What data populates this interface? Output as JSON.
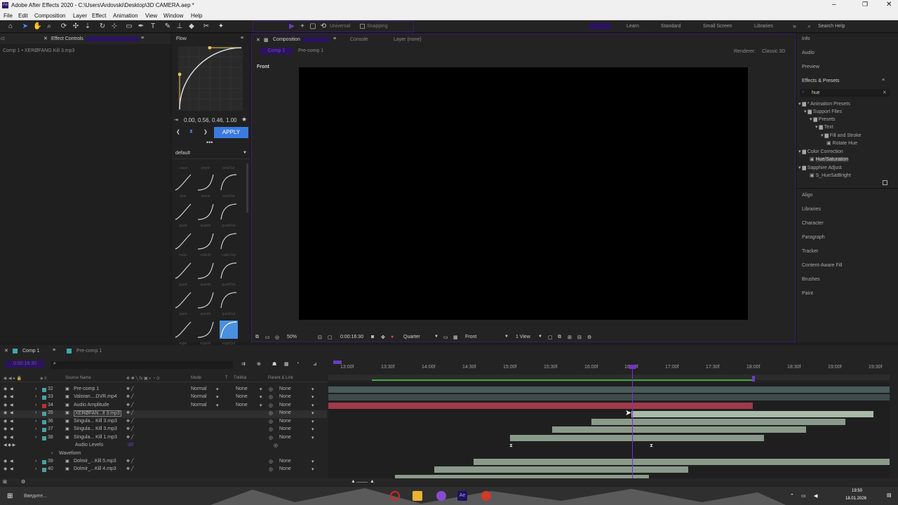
{
  "title_bar": {
    "text": "Adobe After Effects 2020 - C:\\Users\\Ardovski\\Desktop\\3D CAMERA.aep *"
  },
  "menu": [
    "File",
    "Edit",
    "Composition",
    "Layer",
    "Effect",
    "Animation",
    "View",
    "Window",
    "Help"
  ],
  "toolbar": {
    "universal": "Universal",
    "snapping": "Snapping",
    "workspaces": [
      "Learn",
      "Standard",
      "Small Screen",
      "Libraries"
    ],
    "search_placeholder": "Search Help"
  },
  "left_panel": {
    "tab_left": "ct",
    "tab": "Effect Controls",
    "subtitle": "Comp 1 • XERØFANG Kill 3.mp3"
  },
  "flow": {
    "tab": "Flow",
    "values": "0.00, 0.56, 0.46, 1.00",
    "apply": "APPLY",
    "preset": "default",
    "eases": [
      "sine",
      "quad",
      "cubic",
      "quart",
      "quint",
      "expo"
    ],
    "kinds": [
      "In",
      "Out"
    ]
  },
  "composition": {
    "tab": "Composition",
    "console": "Console",
    "layer_tab": "Layer (none)",
    "sub_tab1": "Comp 1",
    "sub_tab2": "Pre-comp 1",
    "renderer_label": "Renderer:",
    "renderer": "Classic 3D",
    "view_label": "Front",
    "zoom": "50%",
    "timecode": "0:00:16:30",
    "resolution": "Quarter",
    "view": "Front",
    "views": "1 View"
  },
  "right_panel": {
    "items": [
      "Info",
      "Audio",
      "Preview"
    ],
    "effects_title": "Effects & Presets",
    "search": "hue",
    "tree": [
      {
        "label": "* Animation Presets",
        "indent": 0
      },
      {
        "label": "Support Files",
        "indent": 1
      },
      {
        "label": "Presets",
        "indent": 2
      },
      {
        "label": "Text",
        "indent": 3
      },
      {
        "label": "Fill and Stroke",
        "indent": 4
      },
      {
        "label": "Rotate Hue",
        "indent": 5
      },
      {
        "label": "Color Correction",
        "indent": 0
      },
      {
        "label": "Hue/Saturation",
        "indent": 2
      },
      {
        "label": "Sapphire Adjust",
        "indent": 0
      },
      {
        "label": "S_HueSatBright",
        "indent": 2
      }
    ],
    "bottom_items": [
      "Align",
      "Libraries",
      "Character",
      "Paragraph",
      "Tracker",
      "Content-Aware Fill",
      "Brushes",
      "Paint"
    ]
  },
  "timeline": {
    "tab1": "Comp 1",
    "tab2": "Pre-comp 1",
    "timecode": "0:00:16:30",
    "headers": {
      "source": "Source Name",
      "mode": "Mode",
      "t": "T",
      "trkmat": "TrkMat",
      "parent": "Parent & Link"
    },
    "ruler": [
      "13:00f",
      "13:30f",
      "14:00f",
      "14:30f",
      "15:00f",
      "15:30f",
      "16:00f",
      "16:30f",
      "17:00f",
      "17:30f",
      "18:00f",
      "18:30f",
      "19:00f",
      "19:30f"
    ],
    "layers": [
      {
        "num": "32",
        "name": "Pre-comp 1",
        "mode": "Normal",
        "trk": "None",
        "parent": "None",
        "color": "#4aa0a0"
      },
      {
        "num": "33",
        "name": "Valoran....DVR.mp4",
        "mode": "Normal",
        "trk": "None",
        "parent": "None",
        "color": "#4aa0a0"
      },
      {
        "num": "34",
        "name": "Audio Amplitude",
        "mode": "Normal",
        "trk": "None",
        "parent": "None",
        "color": "#c03030"
      },
      {
        "num": "35",
        "name": "XERØFAN...ll 3.mp3",
        "mode": "",
        "trk": "",
        "parent": "None",
        "color": "#4aa0a0"
      },
      {
        "num": "36",
        "name": "Singula... Kill 3.mp3",
        "mode": "",
        "trk": "",
        "parent": "None",
        "color": "#4aa0a0"
      },
      {
        "num": "37",
        "name": "Singula... Kill 3.mp3",
        "mode": "",
        "trk": "",
        "parent": "None",
        "color": "#4aa0a0"
      },
      {
        "num": "38",
        "name": "Singula... Kill 1.mp3",
        "mode": "",
        "trk": "",
        "parent": "None",
        "color": "#4aa0a0"
      },
      {
        "num": "39",
        "name": "Dolmir_...Kill 5.mp3",
        "mode": "",
        "trk": "",
        "parent": "None",
        "color": "#4aa0a0"
      },
      {
        "num": "40",
        "name": "Dolmir_...Kill 4.mp3",
        "mode": "",
        "trk": "",
        "parent": "None",
        "color": "#4aa0a0"
      }
    ],
    "audio_levels": "Audio Levels",
    "db": "dB",
    "waveform": "Waveform"
  },
  "taskbar": {
    "search": "Введите...",
    "time": "19:50",
    "date": "18.01.2026"
  }
}
